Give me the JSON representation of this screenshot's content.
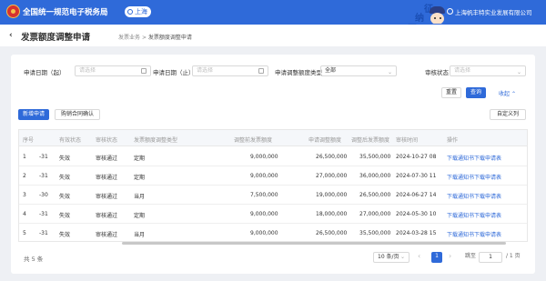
{
  "header": {
    "site_title": "全国统一规范电子税务局",
    "region": "上海",
    "company": "上海帆丰特实业发展有限公司",
    "mascot_chars": [
      "征",
      "纳",
      "互",
      "动"
    ]
  },
  "page": {
    "back_icon": "‹",
    "title": "发票额度调整申请",
    "breadcrumb": [
      "发票业务",
      "发票额度调整申请"
    ],
    "breadcrumb_sep": ">"
  },
  "filters": {
    "start_label": "申请日期（起）",
    "start_placeholder": "请选择",
    "end_label": "申请日期（止）",
    "end_placeholder": "请选择",
    "type_label": "申请调整额度类型",
    "type_value": "全部",
    "status_label": "审核状态",
    "status_placeholder": "请选择"
  },
  "actions": {
    "reset": "重置",
    "query": "查询",
    "collapse": "收起",
    "collapse_icon": "⌃",
    "new_apply": "新增申请",
    "confirm_contract": "购销合同确认",
    "custom_columns": "自定义列"
  },
  "table": {
    "columns": [
      "序号",
      "有效状态",
      "审核状态",
      "发票额度调整类型",
      "调整前发票额度",
      "申请调整额度",
      "调整后发票额度",
      "审核时间",
      "操作"
    ],
    "rows": [
      {
        "seq": "1",
        "cut": "-31",
        "valid": "失效",
        "status": "审核通过",
        "type": "定期",
        "before": "9,000,000",
        "apply": "26,500,000",
        "after": "35,500,000",
        "time": "2024-10-27 08",
        "op1": "下载通知书",
        "op2": "下载申请表"
      },
      {
        "seq": "2",
        "cut": "-31",
        "valid": "失效",
        "status": "审核通过",
        "type": "定期",
        "before": "9,000,000",
        "apply": "27,000,000",
        "after": "36,000,000",
        "time": "2024-07-30 11",
        "op1": "下载通知书",
        "op2": "下载申请表"
      },
      {
        "seq": "3",
        "cut": "-30",
        "valid": "失效",
        "status": "审核通过",
        "type": "当月",
        "before": "7,500,000",
        "apply": "19,000,000",
        "after": "26,500,000",
        "time": "2024-06-27 14",
        "op1": "下载通知书",
        "op2": "下载申请表"
      },
      {
        "seq": "4",
        "cut": "-31",
        "valid": "失效",
        "status": "审核通过",
        "type": "定期",
        "before": "9,000,000",
        "apply": "18,000,000",
        "after": "27,000,000",
        "time": "2024-05-30 10",
        "op1": "下载通知书",
        "op2": "下载申请表"
      },
      {
        "seq": "5",
        "cut": "-31",
        "valid": "失效",
        "status": "审核通过",
        "type": "当月",
        "before": "9,000,000",
        "apply": "26,500,000",
        "after": "35,500,000",
        "time": "2024-03-28 15",
        "op1": "下载通知书",
        "op2": "下载申请表"
      }
    ]
  },
  "pagination": {
    "total": "共 5 条",
    "page_size": "10 条/页",
    "prev_icon": "‹",
    "current_page": "1",
    "next_icon": "›",
    "goto_label": "跳至",
    "goto_value": "1",
    "page_of": "/ 1 页"
  },
  "colors": {
    "primary": "#2f6ad9",
    "header": "#2f6ad9"
  }
}
